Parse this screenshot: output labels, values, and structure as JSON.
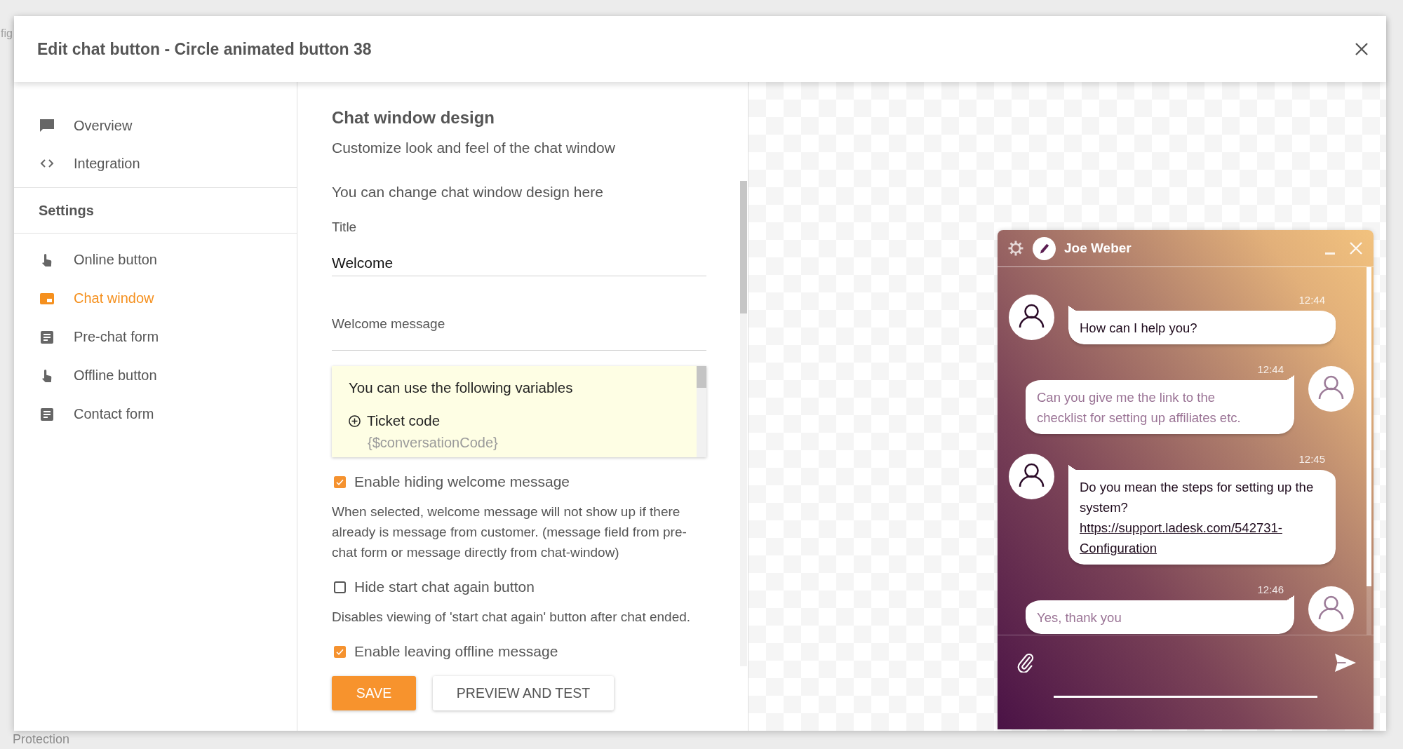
{
  "background": {
    "top_label": "fig",
    "bottom_label": "Protection"
  },
  "dialog": {
    "title": "Edit chat button - Circle animated button 38"
  },
  "sidebar": {
    "items": [
      {
        "label": "Overview",
        "kind": "chat",
        "selected": false
      },
      {
        "label": "Integration",
        "kind": "code",
        "selected": false
      }
    ],
    "sections": [
      {
        "title": "Settings",
        "items": [
          {
            "label": "Online button",
            "kind": "hand",
            "selected": false
          },
          {
            "label": "Chat window",
            "kind": "window",
            "selected": true
          },
          {
            "label": "Pre-chat form",
            "kind": "form",
            "selected": false
          },
          {
            "label": "Offline button",
            "kind": "hand",
            "selected": false
          },
          {
            "label": "Contact form",
            "kind": "form",
            "selected": false
          }
        ]
      }
    ]
  },
  "form": {
    "heading": "Chat window design",
    "subtitle": "Customize look and feel of the chat window",
    "intro": "You can change chat window design here",
    "fields": [
      {
        "label": "Title",
        "value": "Welcome"
      },
      {
        "label": "Welcome message"
      }
    ],
    "variables": {
      "title": "You can use the following variables",
      "items": [
        {
          "name": "Ticket code",
          "code": "{$conversationCode}"
        }
      ]
    },
    "options": [
      {
        "label": "Enable hiding welcome message",
        "checked": true,
        "description": "When selected, welcome message will not show up if there already is message from customer. (message field from pre-chat form or message directly from chat-window)"
      },
      {
        "label": "Hide start chat again button",
        "checked": false,
        "description": "Disables viewing of 'start chat again' button after chat ended."
      },
      {
        "label": "Enable leaving offline message",
        "checked": true
      }
    ],
    "buttons": [
      {
        "label": "SAVE",
        "kind": "primary"
      },
      {
        "label": "PREVIEW AND TEST",
        "kind": "secondary"
      }
    ]
  },
  "chat_preview": {
    "agent_name": "Joe Weber",
    "messages": [
      {
        "kind": "agent",
        "time": "12:44",
        "text": "How can I help you?"
      },
      {
        "kind": "visitor",
        "time": "12:44",
        "text": "Can you give me the link to the checklist for setting up affiliates etc."
      },
      {
        "kind": "agent",
        "time": "12:45",
        "text": "Do you mean the steps for setting up the system?",
        "link": "https://support.ladesk.com/542731-Configuration"
      },
      {
        "kind": "visitor",
        "time": "12:46",
        "text": "Yes, thank you"
      }
    ]
  }
}
